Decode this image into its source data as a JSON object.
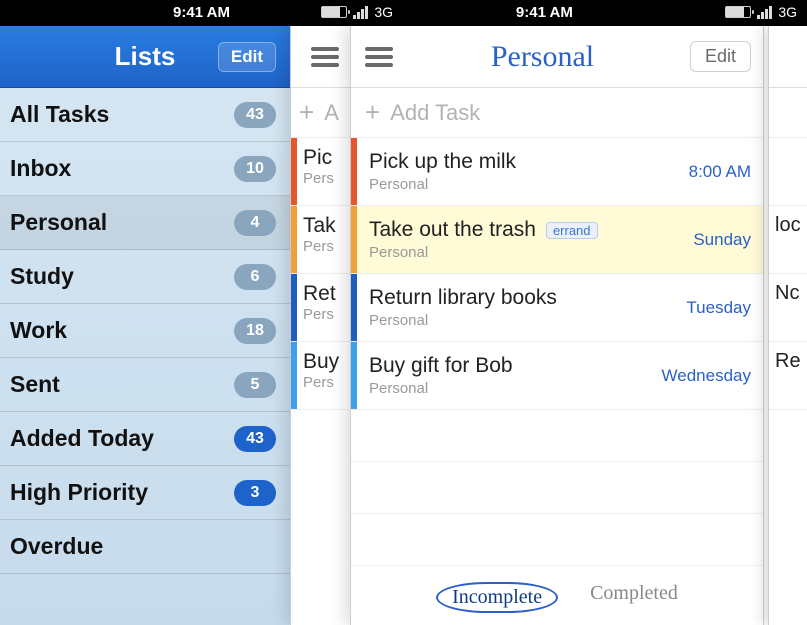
{
  "statusbar": {
    "time": "9:41 AM",
    "network": "3G"
  },
  "lists": {
    "title": "Lists",
    "edit_label": "Edit",
    "items": [
      {
        "label": "All Tasks",
        "count": "43",
        "muted": true,
        "selected": false
      },
      {
        "label": "Inbox",
        "count": "10",
        "muted": true,
        "selected": false
      },
      {
        "label": "Personal",
        "count": "4",
        "muted": true,
        "selected": true
      },
      {
        "label": "Study",
        "count": "6",
        "muted": true,
        "selected": false
      },
      {
        "label": "Work",
        "count": "18",
        "muted": true,
        "selected": false
      },
      {
        "label": "Sent",
        "count": "5",
        "muted": true,
        "selected": false
      },
      {
        "label": "Added Today",
        "count": "43",
        "muted": false,
        "selected": false
      },
      {
        "label": "High Priority",
        "count": "3",
        "muted": false,
        "selected": false
      },
      {
        "label": "Overdue",
        "count": "",
        "muted": false,
        "selected": false
      }
    ]
  },
  "tasks": {
    "header_title": "Personal",
    "edit_label": "Edit",
    "add_placeholder": "Add Task",
    "back_add_placeholder": "A",
    "items": [
      {
        "title": "Pick up the milk",
        "sub": "Personal",
        "meta": "8:00 AM",
        "priority": "red",
        "tag": "",
        "highlight": false,
        "clip_title": "Pic",
        "clip_sub": "Pers"
      },
      {
        "title": "Take out the trash",
        "sub": "Personal",
        "meta": "Sunday",
        "priority": "orange",
        "tag": "errand",
        "highlight": true,
        "clip_title": "Tak",
        "clip_sub": "Pers"
      },
      {
        "title": "Return library books",
        "sub": "Personal",
        "meta": "Tuesday",
        "priority": "blue",
        "tag": "",
        "highlight": false,
        "clip_title": "Ret",
        "clip_sub": "Pers"
      },
      {
        "title": "Buy gift for Bob",
        "sub": "Personal",
        "meta": "Wednesday",
        "priority": "ltblue",
        "tag": "",
        "highlight": false,
        "clip_title": "Buy",
        "clip_sub": "Pers"
      }
    ],
    "footer": {
      "incomplete": "Incomplete",
      "completed": "Completed"
    }
  },
  "far_panel": {
    "rows": [
      "",
      "loc",
      "Nc",
      "Re"
    ]
  }
}
